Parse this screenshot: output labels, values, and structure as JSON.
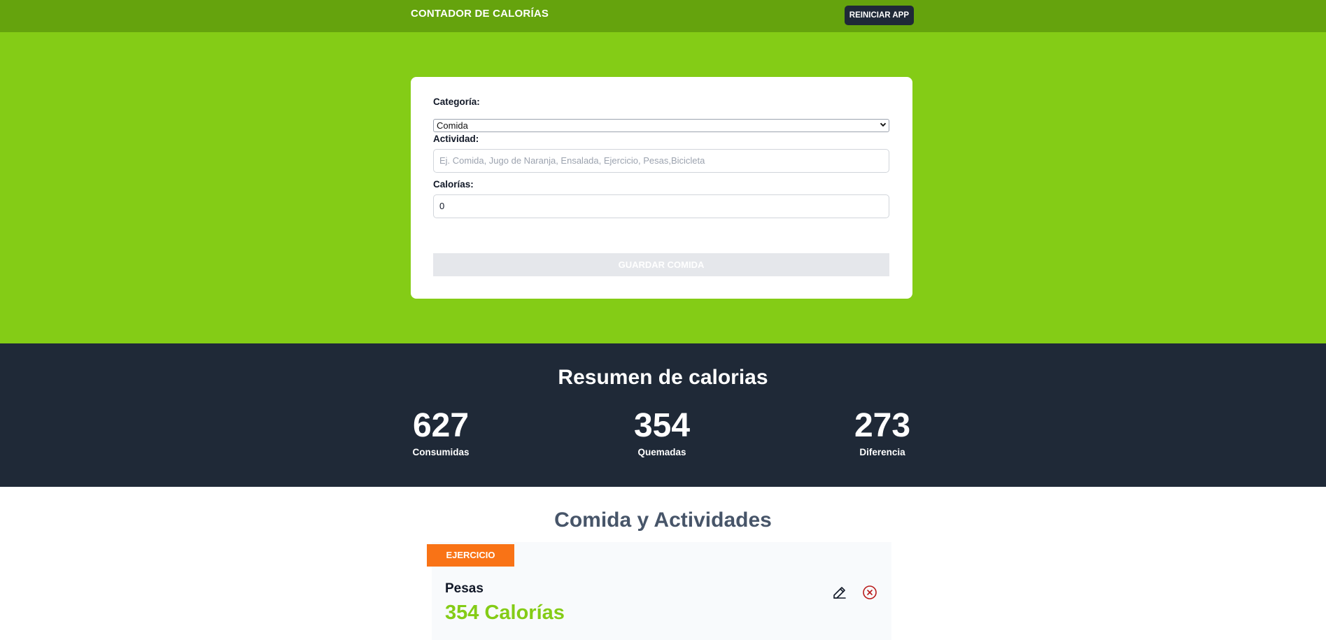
{
  "header": {
    "title": "CONTADOR DE CALORÍAS",
    "reset_label": "REINICIAR APP"
  },
  "form": {
    "category_label": "Categoría:",
    "category_value": "Comida",
    "activity_label": "Actividad:",
    "activity_placeholder": "Ej. Comida, Jugo de Naranja, Ensalada, Ejercicio, Pesas,Bicicleta",
    "calories_label": "Calorías:",
    "calories_value": "0",
    "save_label": "GUARDAR COMIDA"
  },
  "summary": {
    "title": "Resumen de calorias",
    "stats": [
      {
        "value": "627",
        "label": "Consumidas"
      },
      {
        "value": "354",
        "label": "Quemadas"
      },
      {
        "value": "273",
        "label": "Diferencia"
      }
    ]
  },
  "list": {
    "title": "Comida y Actividades",
    "items": [
      {
        "category": "EJERCICIO",
        "name": "Pesas",
        "calories": "354 Calorías",
        "badge_color": "#f97316"
      }
    ]
  },
  "colors": {
    "topbar": "#65a30d",
    "hero": "#84cc16",
    "summary": "#1f2937",
    "calories_text": "#84cc16",
    "delete_icon": "#b91c1c"
  },
  "icons": [
    "edit-icon",
    "delete-icon",
    "chevron-down-icon"
  ]
}
